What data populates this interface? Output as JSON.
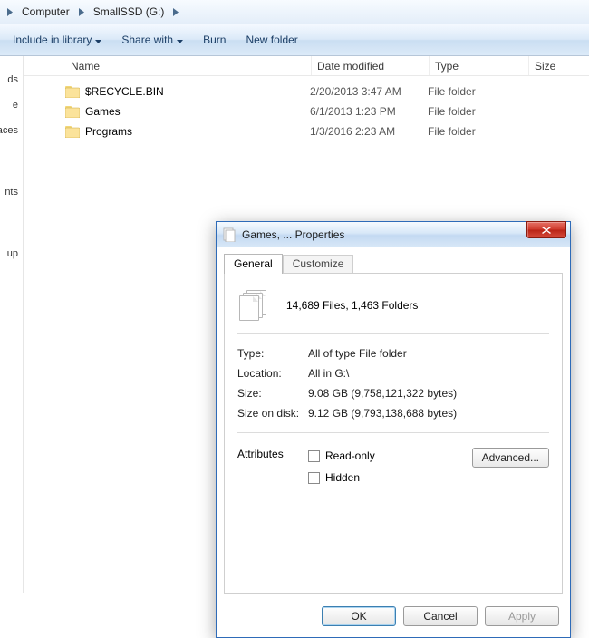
{
  "breadcrumb": {
    "seg1": "Computer",
    "seg2": "SmallSSD (G:)"
  },
  "toolbar": {
    "include": "Include in library",
    "share": "Share with",
    "burn": "Burn",
    "newfolder": "New folder"
  },
  "sidebar": {
    "items": [
      "ds",
      "e",
      "laces",
      "",
      "nts",
      "",
      "up"
    ]
  },
  "columns": {
    "name": "Name",
    "date": "Date modified",
    "type": "Type",
    "size": "Size"
  },
  "files": [
    {
      "name": "$RECYCLE.BIN",
      "date": "2/20/2013 3:47 AM",
      "type": "File folder"
    },
    {
      "name": "Games",
      "date": "6/1/2013 1:23 PM",
      "type": "File folder"
    },
    {
      "name": "Programs",
      "date": "1/3/2016 2:23 AM",
      "type": "File folder"
    }
  ],
  "dialog": {
    "title": "Games, ... Properties",
    "tabs": {
      "general": "General",
      "customize": "Customize"
    },
    "summary": "14,689 Files, 1,463 Folders",
    "type_label": "Type:",
    "type_value": "All of type File folder",
    "loc_label": "Location:",
    "loc_value": "All in G:\\",
    "size_label": "Size:",
    "size_value": "9.08 GB (9,758,121,322 bytes)",
    "sod_label": "Size on disk:",
    "sod_value": "9.12 GB (9,793,138,688 bytes)",
    "attr_label": "Attributes",
    "readonly": "Read-only",
    "hidden": "Hidden",
    "advanced": "Advanced...",
    "ok": "OK",
    "cancel": "Cancel",
    "apply": "Apply"
  }
}
